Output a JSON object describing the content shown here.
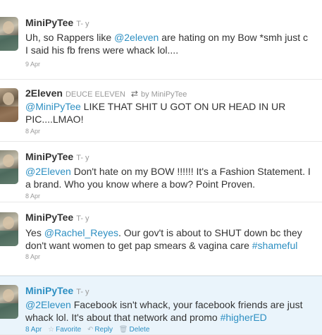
{
  "tweets": [
    {
      "name": "MiniPyTee",
      "handle": "T- y",
      "lines": [
        [
          {
            "t": "Uh, so Rappers like "
          },
          {
            "t": "@2eleven",
            "k": "mention"
          },
          {
            "t": " are hating on my Bow *smh just c"
          }
        ],
        [
          {
            "t": "I said his fb frens were whack lol...."
          }
        ]
      ],
      "date": "9 Apr"
    },
    {
      "name": "2Eleven",
      "handle": "DEUCE ELEVEN",
      "retweet_icon": "retweet-icon",
      "retweet_by": "by MiniPyTee",
      "lines": [
        [
          {
            "t": "@MiniPyTee",
            "k": "mention"
          },
          {
            "t": " LIKE THAT SHIT U GOT ON UR HEAD IN UR"
          }
        ],
        [
          {
            "t": "PIC....LMAO!"
          }
        ]
      ],
      "date": "8 Apr"
    },
    {
      "name": "MiniPyTee",
      "handle": "T- y",
      "lines": [
        [
          {
            "t": "@2Eleven",
            "k": "mention"
          },
          {
            "t": " Don't hate on my BOW !!!!!! It's a Fashion Statement. I"
          }
        ],
        [
          {
            "t": "a brand. Who you know where a bow? Point Proven."
          }
        ]
      ],
      "date": "8 Apr"
    },
    {
      "name": "MiniPyTee",
      "handle": "T- y",
      "lines": [
        [
          {
            "t": "Yes "
          },
          {
            "t": "@Rachel_Reyes",
            "k": "mention"
          },
          {
            "t": ". Our gov't is about to SHUT down bc they"
          }
        ],
        [
          {
            "t": "don't want women to get pap smears & vagina care "
          },
          {
            "t": "#shameful",
            "k": "hashtag"
          }
        ]
      ],
      "date": "8 Apr"
    },
    {
      "name": "MiniPyTee",
      "handle": "T- y",
      "lines": [
        [
          {
            "t": "@2Eleven",
            "k": "mention"
          },
          {
            "t": " Facebook isn't whack, your facebook friends are just"
          }
        ],
        [
          {
            "t": "whack lol. It's about that network and promo "
          },
          {
            "t": "#higherED",
            "k": "hashtag"
          }
        ]
      ],
      "date": "8 Apr",
      "actions": {
        "favorite": "Favorite",
        "reply": "Reply",
        "delete": "Delete",
        "favorite_icon": "star-icon",
        "reply_icon": "reply-icon",
        "delete_icon": "trash-icon"
      }
    }
  ],
  "colors": {
    "link": "#2d8fc2",
    "text": "#333333",
    "muted": "#999999",
    "highlight_bg": "#eaf4fb"
  }
}
